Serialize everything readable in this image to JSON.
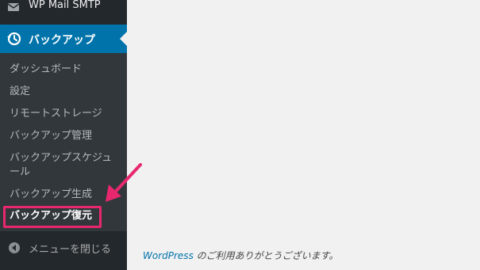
{
  "sidebar": {
    "wp_mail_smtp": {
      "label": "WP Mail SMTP",
      "icon": "mail-icon"
    },
    "backup": {
      "label": "バックアップ",
      "icon": "history-icon"
    },
    "submenu": [
      {
        "label": "ダッシュボード"
      },
      {
        "label": "設定"
      },
      {
        "label": "リモートストレージ"
      },
      {
        "label": "バックアップ管理"
      },
      {
        "label": "バックアップスケジュール"
      },
      {
        "label": "バックアップ生成"
      },
      {
        "label": "バックアップ復元",
        "current": true
      }
    ],
    "collapse": {
      "label": "メニューを閉じる",
      "icon": "collapse-arrow-icon"
    }
  },
  "footer": {
    "link": "WordPress",
    "text": " のご利用ありがとうございます。"
  },
  "colors": {
    "sidebar_bg": "#23282d",
    "submenu_bg": "#32373c",
    "active_blue": "#0073aa",
    "highlight_pink": "#e8276f"
  }
}
